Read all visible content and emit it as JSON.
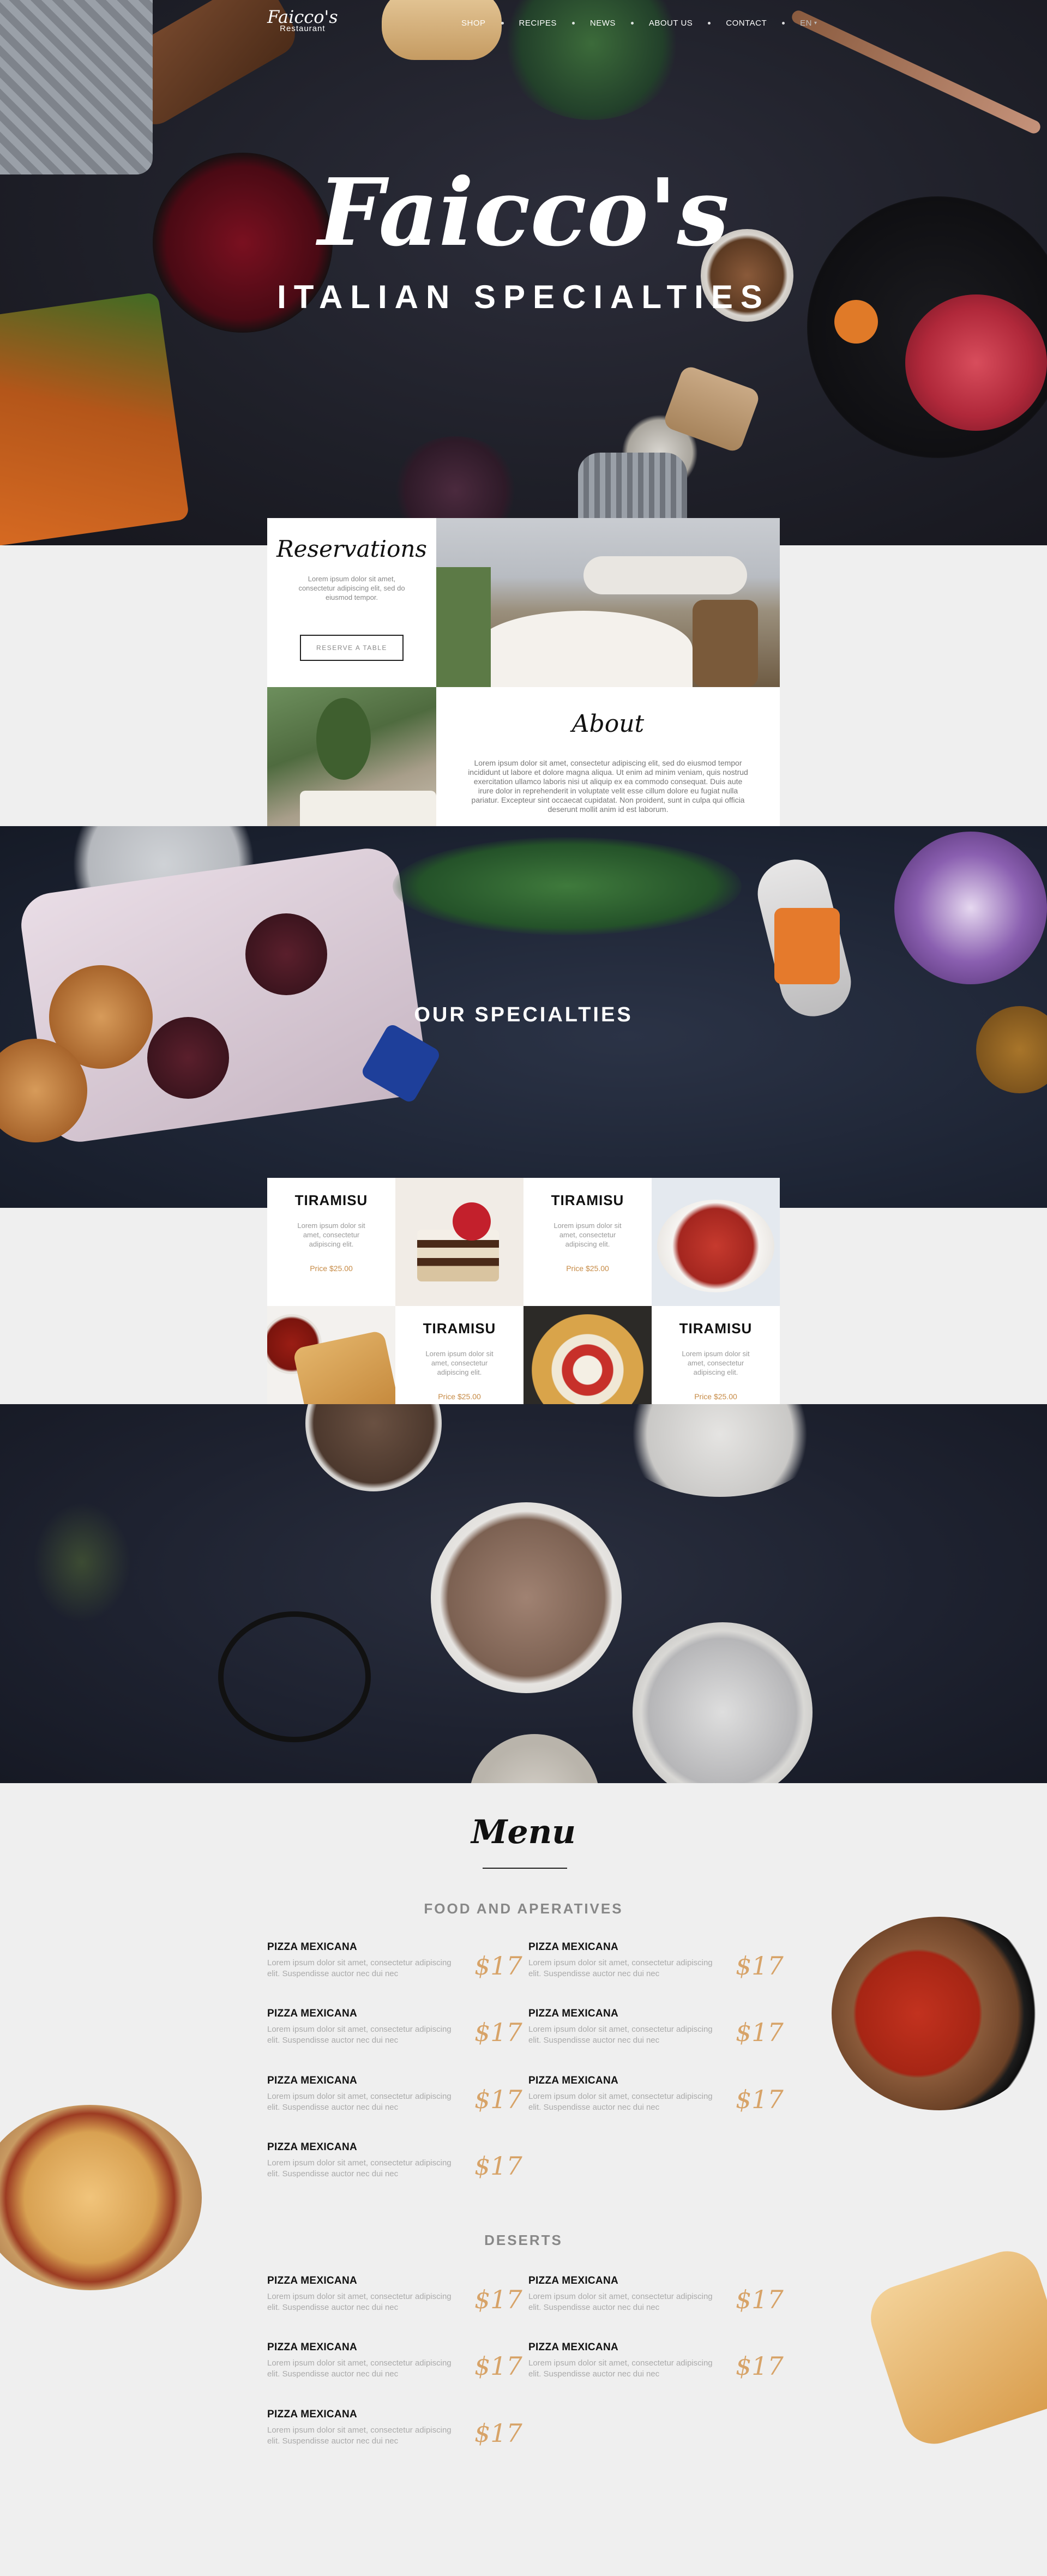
{
  "nav": {
    "logo_script": "Faicco's",
    "logo_sub": "Restaurant",
    "items": [
      "SHOP",
      "RECIPES",
      "NEWS",
      "ABOUT US",
      "CONTACT"
    ],
    "lang": "EN"
  },
  "hero": {
    "title": "Faicco's",
    "subtitle": "ITALIAN SPECIALTIES"
  },
  "reservations": {
    "title": "Reservations",
    "text": "Lorem ipsum dolor sit amet, consectetur adipiscing elit, sed do eiusmod tempor.",
    "button": "RESERVE A TABLE"
  },
  "about": {
    "title": "About",
    "text": "Lorem ipsum dolor sit amet, consectetur adipiscing elit, sed do eiusmod tempor incididunt ut labore et dolore magna aliqua. Ut enim ad minim veniam, quis nostrud exercitation ullamco laboris nisi ut aliquip ex ea commodo consequat. Duis aute irure dolor in reprehenderit in voluptate velit esse cillum dolore eu fugiat nulla pariatur. Excepteur sint occaecat cupidatat. Non proident, sunt in culpa qui officia deserunt mollit anim id est laborum."
  },
  "specialties": {
    "title": "OUR SPECIALTIES",
    "dishes": [
      {
        "name": "TIRAMISU",
        "desc": "Lorem ipsum dolor sit amet, consectetur adipiscing elit.",
        "price": "Price $25.00"
      },
      {
        "name": "TIRAMISU",
        "desc": "Lorem ipsum dolor sit amet, consectetur adipiscing elit.",
        "price": "Price $25.00"
      },
      {
        "name": "TIRAMISU",
        "desc": "Lorem ipsum dolor sit amet, consectetur adipiscing elit.",
        "price": "Price $25.00"
      },
      {
        "name": "TIRAMISU",
        "desc": "Lorem ipsum dolor sit amet, consectetur adipiscing elit.",
        "price": "Price $25.00"
      }
    ]
  },
  "menu": {
    "title": "Menu",
    "food_title": "FOOD AND APERATIVES",
    "food": [
      {
        "name": "PIZZA MEXICANA",
        "desc": "Lorem ipsum dolor sit amet, consectetur adipiscing elit. Suspendisse auctor nec dui nec",
        "price": "$17"
      },
      {
        "name": "PIZZA MEXICANA",
        "desc": "Lorem ipsum dolor sit amet, consectetur adipiscing elit. Suspendisse auctor nec dui nec",
        "price": "$17"
      },
      {
        "name": "PIZZA MEXICANA",
        "desc": "Lorem ipsum dolor sit amet, consectetur adipiscing elit. Suspendisse auctor nec dui nec",
        "price": "$17"
      },
      {
        "name": "PIZZA MEXICANA",
        "desc": "Lorem ipsum dolor sit amet, consectetur adipiscing elit. Suspendisse auctor nec dui nec",
        "price": "$17"
      },
      {
        "name": "PIZZA MEXICANA",
        "desc": "Lorem ipsum dolor sit amet, consectetur adipiscing elit. Suspendisse auctor nec dui nec",
        "price": "$17"
      },
      {
        "name": "PIZZA MEXICANA",
        "desc": "Lorem ipsum dolor sit amet, consectetur adipiscing elit. Suspendisse auctor nec dui nec",
        "price": "$17"
      },
      {
        "name": "PIZZA MEXICANA",
        "desc": "Lorem ipsum dolor sit amet, consectetur adipiscing elit. Suspendisse auctor nec dui nec",
        "price": "$17"
      }
    ],
    "desserts_title": "DESERTS",
    "desserts": [
      {
        "name": "PIZZA MEXICANA",
        "desc": "Lorem ipsum dolor sit amet, consectetur adipiscing elit. Suspendisse auctor nec dui nec",
        "price": "$17"
      },
      {
        "name": "PIZZA MEXICANA",
        "desc": "Lorem ipsum dolor sit amet, consectetur adipiscing elit. Suspendisse auctor nec dui nec",
        "price": "$17"
      },
      {
        "name": "PIZZA MEXICANA",
        "desc": "Lorem ipsum dolor sit amet, consectetur adipiscing elit. Suspendisse auctor nec dui nec",
        "price": "$17"
      },
      {
        "name": "PIZZA MEXICANA",
        "desc": "Lorem ipsum dolor sit amet, consectetur adipiscing elit. Suspendisse auctor nec dui nec",
        "price": "$17"
      },
      {
        "name": "PIZZA MEXICANA",
        "desc": "Lorem ipsum dolor sit amet, consectetur adipiscing elit. Suspendisse auctor nec dui nec",
        "price": "$17"
      }
    ]
  },
  "colors": {
    "accent": "#d7a368",
    "price": "#c68a45",
    "dark": "#1f2029",
    "light": "#efefef"
  }
}
